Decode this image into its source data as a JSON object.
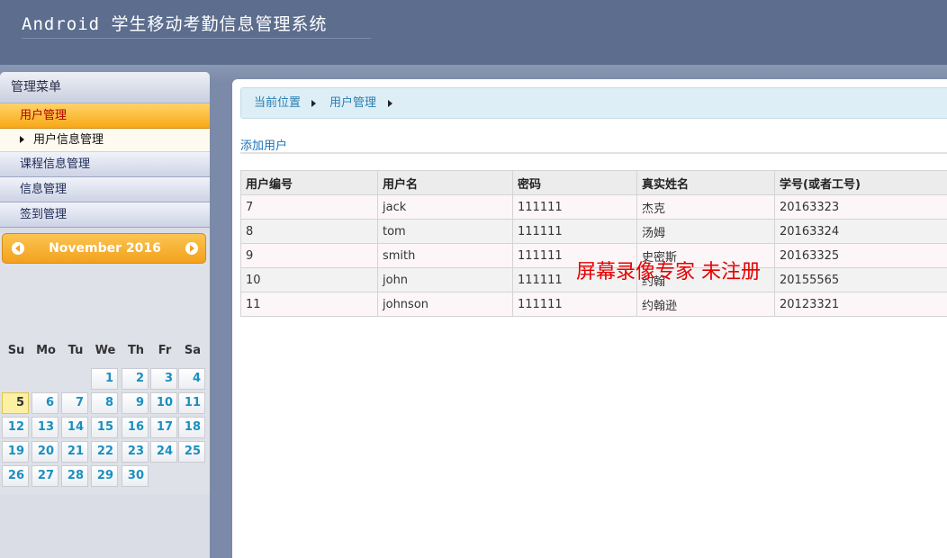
{
  "app": {
    "title": "Android 学生移动考勤信息管理系统"
  },
  "sidebar": {
    "title": "管理菜单",
    "items": [
      {
        "label": "用户管理",
        "active": true,
        "subitems": [
          {
            "label": "用户信息管理"
          }
        ]
      },
      {
        "label": "课程信息管理"
      },
      {
        "label": "信息管理"
      },
      {
        "label": "签到管理"
      }
    ]
  },
  "calendar": {
    "month_title": "November 2016",
    "prev_icon": "chevron-left-icon",
    "next_icon": "chevron-right-icon",
    "weekdays": [
      "Su",
      "Mo",
      "Tu",
      "We",
      "Th",
      "Fr",
      "Sa"
    ],
    "weeks": [
      [
        "",
        "",
        "",
        "1",
        "2",
        "3",
        "4"
      ],
      [
        "5",
        "6",
        "7",
        "8",
        "9",
        "10",
        "11"
      ],
      [
        "12",
        "13",
        "14",
        "15",
        "16",
        "17",
        "18"
      ],
      [
        "19",
        "20",
        "21",
        "22",
        "23",
        "24",
        "25"
      ],
      [
        "26",
        "27",
        "28",
        "29",
        "30",
        "",
        ""
      ]
    ],
    "today": "5"
  },
  "breadcrumb": {
    "items": [
      "当前位置",
      "用户管理"
    ]
  },
  "main": {
    "add_link": "添加用户",
    "table": {
      "columns": [
        "用户编号",
        "用户名",
        "密码",
        "真实姓名",
        "学号(或者工号)"
      ],
      "rows": [
        [
          "7",
          "jack",
          "111111",
          "杰克",
          "20163323"
        ],
        [
          "8",
          "tom",
          "111111",
          "汤姆",
          "20163324"
        ],
        [
          "9",
          "smith",
          "111111",
          "史密斯",
          "20163325"
        ],
        [
          "10",
          "john",
          "111111",
          "约翰",
          "20155565"
        ],
        [
          "11",
          "johnson",
          "111111",
          "约翰逊",
          "20123321"
        ]
      ]
    }
  },
  "watermark": "屏幕录像专家 未注册",
  "colors": {
    "header": "#5c6d8e",
    "active_menu": "#f8a915",
    "link": "#1a73b8",
    "watermark": "#e60000"
  }
}
